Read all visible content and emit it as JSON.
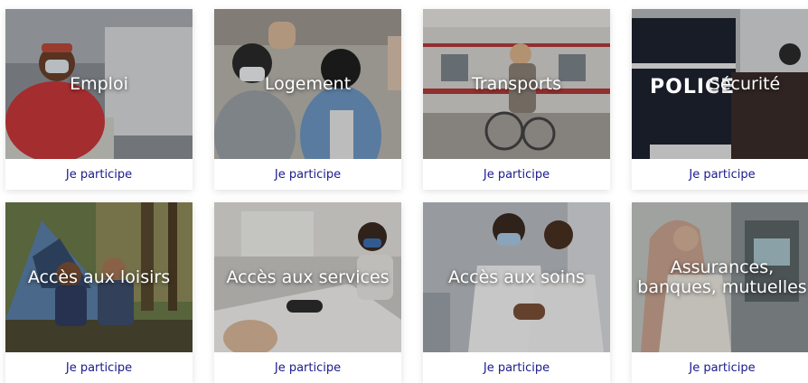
{
  "link_label": "Je participe",
  "colors": {
    "link": "#1a1a8c",
    "title": "#ffffff"
  },
  "cards": [
    {
      "title": "Emploi",
      "image": "woman-with-mask-at-desk"
    },
    {
      "title": "Logement",
      "image": "child-receiving-keys"
    },
    {
      "title": "Transports",
      "image": "wheelchair-user-at-train"
    },
    {
      "title": "Sécurité",
      "image": "police-officer",
      "sign": "POLICE"
    },
    {
      "title": "Accès aux loisirs",
      "image": "family-camping"
    },
    {
      "title": "Accès aux services",
      "image": "desk-with-papers"
    },
    {
      "title": "Accès aux soins",
      "image": "doctor-vaccinating-patient"
    },
    {
      "title": "Assurances,\nbanques, mutuelles",
      "image": "woman-at-atm"
    }
  ]
}
